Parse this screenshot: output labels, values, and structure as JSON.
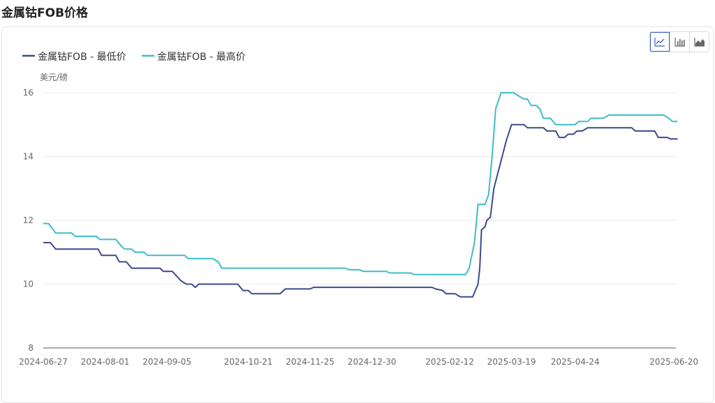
{
  "page": {
    "title": "金属钴FOB价格"
  },
  "toolbar": {
    "buttons": [
      {
        "icon": "line-chart-icon",
        "active": true
      },
      {
        "icon": "bar-chart-icon",
        "active": false
      },
      {
        "icon": "area-chart-icon",
        "active": false
      }
    ]
  },
  "chart_data": {
    "type": "line",
    "title": "",
    "xlabel": "",
    "ylabel": "美元/磅",
    "ylim": [
      8,
      16
    ],
    "yticks": [
      8,
      10,
      12,
      14,
      16
    ],
    "xticks": [
      "2024-06-27",
      "2024-08-01",
      "2024-09-05",
      "2024-10-21",
      "2024-11-25",
      "2024-12-30",
      "2025-02-12",
      "2025-03-19",
      "2025-04-24",
      "2025-06-20"
    ],
    "grid": true,
    "legend_position": "top-left",
    "colors": {
      "low": "#3b4a8c",
      "high": "#3fbcc9"
    },
    "series": [
      {
        "name": "金属钴FOB - 最低价",
        "points": [
          [
            "2024-06-27",
            11.3
          ],
          [
            "2024-07-01",
            11.3
          ],
          [
            "2024-07-04",
            11.1
          ],
          [
            "2024-07-28",
            11.1
          ],
          [
            "2024-07-30",
            10.9
          ],
          [
            "2024-08-07",
            10.9
          ],
          [
            "2024-08-09",
            10.7
          ],
          [
            "2024-08-13",
            10.7
          ],
          [
            "2024-08-16",
            10.5
          ],
          [
            "2024-09-01",
            10.5
          ],
          [
            "2024-09-03",
            10.4
          ],
          [
            "2024-09-08",
            10.4
          ],
          [
            "2024-09-13",
            10.1
          ],
          [
            "2024-09-16",
            10.0
          ],
          [
            "2024-09-19",
            10.0
          ],
          [
            "2024-09-21",
            9.9
          ],
          [
            "2024-09-23",
            10.0
          ],
          [
            "2024-10-15",
            10.0
          ],
          [
            "2024-10-18",
            9.8
          ],
          [
            "2024-10-21",
            9.8
          ],
          [
            "2024-10-23",
            9.7
          ],
          [
            "2024-11-08",
            9.7
          ],
          [
            "2024-11-11",
            9.85
          ],
          [
            "2024-11-25",
            9.85
          ],
          [
            "2024-11-27",
            9.9
          ],
          [
            "2025-02-02",
            9.9
          ],
          [
            "2025-02-04",
            9.85
          ],
          [
            "2025-02-08",
            9.8
          ],
          [
            "2025-02-10",
            9.7
          ],
          [
            "2025-02-15",
            9.7
          ],
          [
            "2025-02-18",
            9.6
          ],
          [
            "2025-02-25",
            9.6
          ],
          [
            "2025-02-28",
            10.0
          ],
          [
            "2025-03-01",
            10.5
          ],
          [
            "2025-03-02",
            11.7
          ],
          [
            "2025-03-04",
            11.8
          ],
          [
            "2025-03-05",
            12.0
          ],
          [
            "2025-03-07",
            12.1
          ],
          [
            "2025-03-09",
            13.0
          ],
          [
            "2025-03-16",
            14.5
          ],
          [
            "2025-03-19",
            15.0
          ],
          [
            "2025-03-26",
            15.0
          ],
          [
            "2025-03-28",
            14.9
          ],
          [
            "2025-04-06",
            14.9
          ],
          [
            "2025-04-08",
            14.8
          ],
          [
            "2025-04-13",
            14.8
          ],
          [
            "2025-04-15",
            14.6
          ],
          [
            "2025-04-18",
            14.6
          ],
          [
            "2025-04-20",
            14.7
          ],
          [
            "2025-04-23",
            14.7
          ],
          [
            "2025-04-25",
            14.8
          ],
          [
            "2025-04-28",
            14.8
          ],
          [
            "2025-05-01",
            14.9
          ],
          [
            "2025-05-26",
            14.9
          ],
          [
            "2025-05-28",
            14.8
          ],
          [
            "2025-06-08",
            14.8
          ],
          [
            "2025-06-10",
            14.6
          ],
          [
            "2025-06-15",
            14.6
          ],
          [
            "2025-06-17",
            14.55
          ],
          [
            "2025-06-21",
            14.55
          ]
        ]
      },
      {
        "name": "金属钴FOB - 最高价",
        "points": [
          [
            "2024-06-27",
            11.9
          ],
          [
            "2024-06-30",
            11.9
          ],
          [
            "2024-07-04",
            11.6
          ],
          [
            "2024-07-13",
            11.6
          ],
          [
            "2024-07-15",
            11.5
          ],
          [
            "2024-07-27",
            11.5
          ],
          [
            "2024-07-29",
            11.4
          ],
          [
            "2024-08-07",
            11.4
          ],
          [
            "2024-08-10",
            11.2
          ],
          [
            "2024-08-12",
            11.1
          ],
          [
            "2024-08-16",
            11.1
          ],
          [
            "2024-08-18",
            11.0
          ],
          [
            "2024-08-23",
            11.0
          ],
          [
            "2024-08-25",
            10.9
          ],
          [
            "2024-09-15",
            10.9
          ],
          [
            "2024-09-17",
            10.8
          ],
          [
            "2024-10-01",
            10.8
          ],
          [
            "2024-10-04",
            10.7
          ],
          [
            "2024-10-06",
            10.5
          ],
          [
            "2024-12-15",
            10.5
          ],
          [
            "2024-12-17",
            10.45
          ],
          [
            "2024-12-23",
            10.45
          ],
          [
            "2024-12-25",
            10.4
          ],
          [
            "2025-01-07",
            10.4
          ],
          [
            "2025-01-09",
            10.35
          ],
          [
            "2025-01-21",
            10.35
          ],
          [
            "2025-01-23",
            10.3
          ],
          [
            "2025-02-21",
            10.3
          ],
          [
            "2025-02-23",
            10.5
          ],
          [
            "2025-02-26",
            11.3
          ],
          [
            "2025-02-28",
            12.5
          ],
          [
            "2025-03-04",
            12.5
          ],
          [
            "2025-03-06",
            12.8
          ],
          [
            "2025-03-08",
            14.0
          ],
          [
            "2025-03-10",
            15.5
          ],
          [
            "2025-03-13",
            16.0
          ],
          [
            "2025-03-20",
            16.0
          ],
          [
            "2025-03-23",
            15.9
          ],
          [
            "2025-03-26",
            15.8
          ],
          [
            "2025-03-28",
            15.8
          ],
          [
            "2025-03-30",
            15.6
          ],
          [
            "2025-04-02",
            15.6
          ],
          [
            "2025-04-04",
            15.5
          ],
          [
            "2025-04-06",
            15.2
          ],
          [
            "2025-04-10",
            15.2
          ],
          [
            "2025-04-13",
            15.0
          ],
          [
            "2025-04-24",
            15.0
          ],
          [
            "2025-04-26",
            15.1
          ],
          [
            "2025-05-01",
            15.1
          ],
          [
            "2025-05-03",
            15.2
          ],
          [
            "2025-05-10",
            15.2
          ],
          [
            "2025-05-13",
            15.3
          ],
          [
            "2025-06-13",
            15.3
          ],
          [
            "2025-06-16",
            15.2
          ],
          [
            "2025-06-18",
            15.1
          ],
          [
            "2025-06-21",
            15.1
          ]
        ]
      }
    ]
  }
}
